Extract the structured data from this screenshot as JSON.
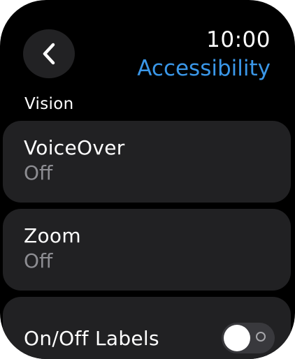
{
  "status_bar": {
    "time": "10:00"
  },
  "header": {
    "title": "Accessibility",
    "back_icon": "chevron-left-icon"
  },
  "colors": {
    "accent": "#3a97e8",
    "background": "#000000",
    "cell": "#212123",
    "secondary_text": "#8d8d92"
  },
  "sections": [
    {
      "header": "Vision",
      "rows": [
        {
          "label": "VoiceOver",
          "value": "Off"
        },
        {
          "label": "Zoom",
          "value": "Off"
        },
        {
          "label": "On/Off Labels",
          "toggle_on": false
        }
      ]
    }
  ]
}
